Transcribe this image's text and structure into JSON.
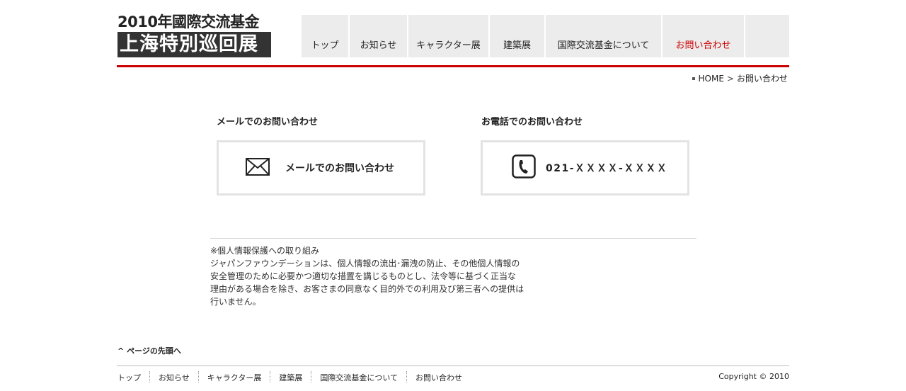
{
  "logo": {
    "line1": "2010年國際交流基金",
    "line2": "上海特別巡回展"
  },
  "nav": {
    "items": [
      {
        "label": "トップ"
      },
      {
        "label": "お知らせ"
      },
      {
        "label": "キャラクター展"
      },
      {
        "label": "建築展"
      },
      {
        "label": "国際交流基金について"
      },
      {
        "label": "お問い合わせ",
        "active": true
      }
    ]
  },
  "breadcrumb": {
    "home": "HOME",
    "separator": ">",
    "current": "お問い合わせ"
  },
  "contact": {
    "mail": {
      "title": "メールでのお問い合わせ",
      "button_label": "メールでのお問い合わせ",
      "icon": "envelope-icon"
    },
    "phone": {
      "title": "お電話でのお問い合わせ",
      "number": "021-ＸＸＸＸ-ＸＸＸＸ",
      "icon": "phone-icon"
    }
  },
  "privacy": {
    "heading": "※個人情報保護への取り組み",
    "lines": [
      "ジャパンファウンデーションは、個人情報の流出･漏洩の防止、その他個人情報の",
      "安全管理のために必要かつ適切な措置を講じるものとし、法令等に基づく正当な",
      "理由がある場合を除き、お客さまの同意なく目的外での利用及び第三者への提供は",
      "行いません。"
    ]
  },
  "footer": {
    "pagetop": "ページの先頭へ",
    "pagetop_icon": "^",
    "nav": [
      "トップ",
      "お知らせ",
      "キャラクター展",
      "建築展",
      "国際交流基金について",
      "お問い合わせ"
    ],
    "copyright": "Copyright  © 2010"
  },
  "colors": {
    "accent": "#cc0000",
    "nav_bg": "#ececec",
    "logo_bg": "#333333",
    "box_border": "#e3e3e3"
  }
}
